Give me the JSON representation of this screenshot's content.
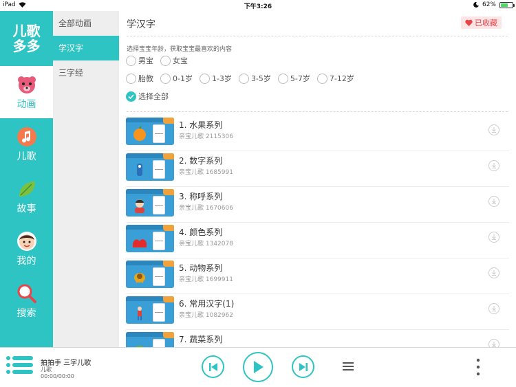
{
  "statusbar": {
    "device": "iPad",
    "time": "下午3:26",
    "battery": "62%"
  },
  "sidebar": {
    "logo_line1": "儿歌",
    "logo_line2": "多多",
    "items": [
      {
        "label": "动画",
        "icon": "bear-icon",
        "active": true
      },
      {
        "label": "儿歌",
        "icon": "music-note-icon",
        "active": false
      },
      {
        "label": "故事",
        "icon": "leaf-icon",
        "active": false
      },
      {
        "label": "我的",
        "icon": "child-face-icon",
        "active": false
      },
      {
        "label": "搜索",
        "icon": "magnifier-icon",
        "active": false
      }
    ]
  },
  "categories": [
    {
      "label": "全部动画",
      "active": false
    },
    {
      "label": "学汉字",
      "active": true
    },
    {
      "label": "三字经",
      "active": false
    }
  ],
  "main": {
    "title": "学汉字",
    "favorite_label": "已收藏",
    "filter_hint": "选择宝宝年龄，获取宝宝最喜欢的内容",
    "gender_options": [
      "男宝",
      "女宝"
    ],
    "age_options": [
      "胎教",
      "0-1岁",
      "1-3岁",
      "3-5岁",
      "5-7岁",
      "7-12岁"
    ],
    "select_all_label": "选择全部"
  },
  "list": [
    {
      "title": "1. 水果系列",
      "sub": "亲宝儿歌 2115306"
    },
    {
      "title": "2. 数字系列",
      "sub": "亲宝儿歌 1685991"
    },
    {
      "title": "3. 称呼系列",
      "sub": "亲宝儿歌 1670606"
    },
    {
      "title": "4. 颜色系列",
      "sub": "亲宝儿歌 1342078"
    },
    {
      "title": "5. 动物系列",
      "sub": "亲宝儿歌 1699911"
    },
    {
      "title": "6. 常用汉字(1)",
      "sub": "亲宝儿歌 1082962"
    },
    {
      "title": "7. 蔬菜系列",
      "sub": ""
    }
  ],
  "player": {
    "title": "拍拍手  三字儿歌",
    "artist": "儿歌",
    "time": "00:00/00:00"
  },
  "colors": {
    "accent": "#2ec4c3",
    "favorite": "#e8454b"
  }
}
